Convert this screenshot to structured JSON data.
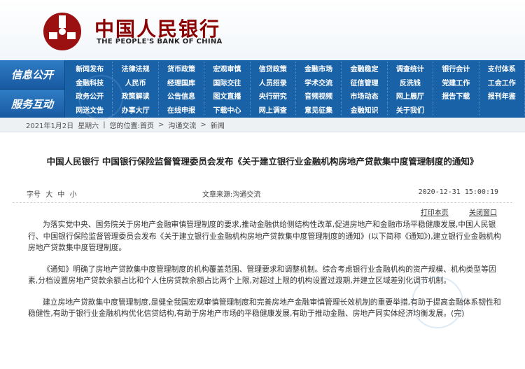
{
  "header": {
    "cn_name": "中国人民银行",
    "en_name": "THE PEOPLE'S BANK OF CHINA"
  },
  "nav": {
    "section1": "信息公开",
    "section2": "服务互动",
    "rows": [
      [
        "新闻发布",
        "法律法规",
        "货币政策",
        "宏观审慎",
        "信贷政策",
        "金融市场",
        "金融稳定",
        "调查统计",
        "银行会计",
        "支付体系"
      ],
      [
        "金融科技",
        "人民币",
        "经理国库",
        "国际交往",
        "人员招录",
        "学术交流",
        "征信管理",
        "反洗钱",
        "党建工作",
        "工会工作"
      ],
      [
        "政务公开",
        "政策解读",
        "公告信息",
        "图文直播",
        "央行研究",
        "音频视频",
        "市场动态",
        "网上展厅",
        "报告下载",
        "报刊年鉴"
      ],
      [
        "网送文告",
        "办事大厅",
        "在线申报",
        "下载中心",
        "网上调查",
        "意见征集",
        "金融知识",
        "关于我们",
        "",
        ""
      ]
    ]
  },
  "breadcrumb": {
    "date": "2021年1月2日",
    "weekday": "星期六",
    "location_label": "您的位置:首页",
    "level1": "沟通交流",
    "level2": "新闻",
    "sep": "|",
    "arrow": ">"
  },
  "article": {
    "title": "中国人民银行 中国银行保险监督管理委员会发布《关于建立银行业金融机构房地产贷款集中度管理制度的通知》",
    "font_size_label": "字号",
    "font_sizes": [
      "大",
      "中",
      "小"
    ],
    "source": "文章来源:沟通交流",
    "time": "2020-12-31 15:00:19",
    "print_label": "打印本页",
    "close_label": "关闭窗口",
    "paragraphs": [
      "为落实党中央、国务院关于房地产金融审慎管理制度的要求,推动金融供给侧结构性改革,促进房地产和金融市场平稳健康发展,中国人民银行、中国银行保险监督管理委员会发布《关于建立银行业金融机构房地产贷款集中度管理制度的通知》(以下简称《通知》),建立银行业金融机构房地产贷款集中度管理制度。",
      "《通知》明确了房地产贷款集中度管理制度的机构覆盖范围、管理要求和调整机制。综合考虑银行业金融机构的资产规模、机构类型等因素,分档设置房地产贷款余额占比和个人住房贷款余额占比两个上限,对超过上限的机构设置过渡期,并建立区域差别化调节机制。",
      "建立房地产贷款集中度管理制度,是健全我国宏观审慎管理制度和完善房地产金融审慎管理长效机制的重要举措,有助于提高金融体系韧性和稳健性,有助于银行业金融机构优化信贷结构,有助于房地产市场的平稳健康发展,有助于推动金融、房地产同实体经济均衡发展。(完)"
    ]
  },
  "colors": {
    "brand_red": "#8b0000",
    "nav_blue": "#1a62a8"
  }
}
